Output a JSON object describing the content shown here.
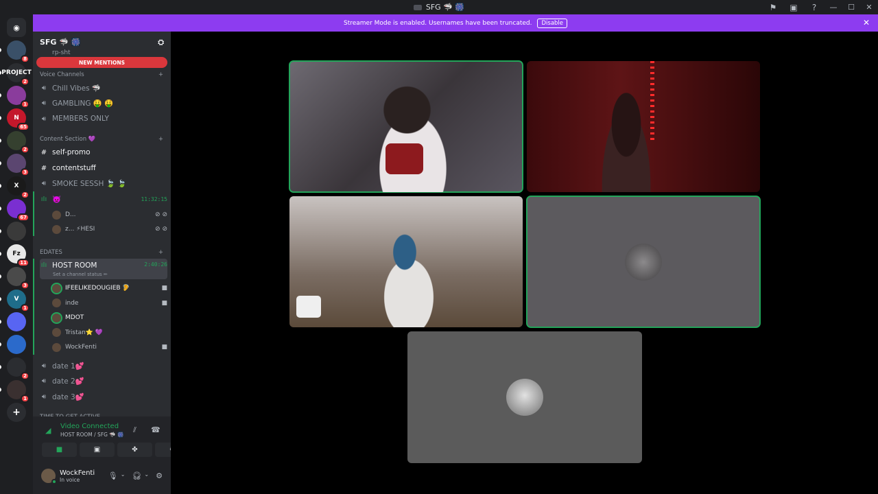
{
  "window": {
    "title": "SFG 🦈 🎆"
  },
  "streamer_banner": {
    "text": "Streamer Mode is enabled. Usernames have been truncated.",
    "button": "Disable"
  },
  "guilds": [
    {
      "label": "",
      "badge": "8"
    },
    {
      "label": "PROJECT",
      "badge": "2"
    },
    {
      "label": "",
      "badge": "1"
    },
    {
      "label": "N",
      "badge": "65"
    },
    {
      "label": "",
      "badge": "2"
    },
    {
      "label": "",
      "badge": "3"
    },
    {
      "label": "X",
      "badge": "2"
    },
    {
      "label": "",
      "badge": "67"
    },
    {
      "label": "",
      "badge": ""
    },
    {
      "label": "Fz",
      "badge": "11"
    },
    {
      "label": "",
      "badge": "3"
    },
    {
      "label": "V",
      "badge": "1"
    },
    {
      "label": "",
      "badge": ""
    },
    {
      "label": "",
      "badge": ""
    },
    {
      "label": "",
      "badge": "2"
    },
    {
      "label": "",
      "badge": "1"
    }
  ],
  "server": {
    "name": "SFG 🦈 🎆",
    "new_mentions": "NEW MENTIONS",
    "partial_channel": "rp-sht"
  },
  "categories": {
    "voice": "Voice Channels",
    "content": "Content Section 💜",
    "edates": "EDATES",
    "time": "TIME TO GET ACTIVE"
  },
  "channels": {
    "chill": "Chill Vibes 🦈",
    "gambling": "GAMBLING 🤑 🤑",
    "members": "MEMBERS ONLY",
    "selfpromo": "self-promo",
    "contentstuff": "contentstuff",
    "smoke": "SMOKE SESSH 🍃 🍃",
    "unnamed_voice": "👿",
    "unnamed_time": "11:32:15",
    "host_room": "HOST ROOM",
    "host_time": "2:40:26",
    "host_status": "Set a channel status ✏",
    "date1": "date 1💕",
    "date2": "date 2💕",
    "date3": "date 3💕"
  },
  "smoke_users": [
    {
      "name": "D..."
    },
    {
      "name": "z... ⚡HESI"
    }
  ],
  "host_users": [
    {
      "name": "IFEELIKEDOUGIEB 🦻"
    },
    {
      "name": "inde"
    },
    {
      "name": "MDOT"
    },
    {
      "name": "Tristan⭐ 💜"
    },
    {
      "name": "WockFenti"
    }
  ],
  "voice_panel": {
    "status": "Video Connected",
    "sub": "HOST ROOM / SFG 🦈 🎆",
    "user": "WockFenti",
    "user_status": "In voice"
  },
  "colors": {
    "accent": "#23a55a",
    "banner": "#8d3cf0",
    "mention": "#da373c"
  }
}
